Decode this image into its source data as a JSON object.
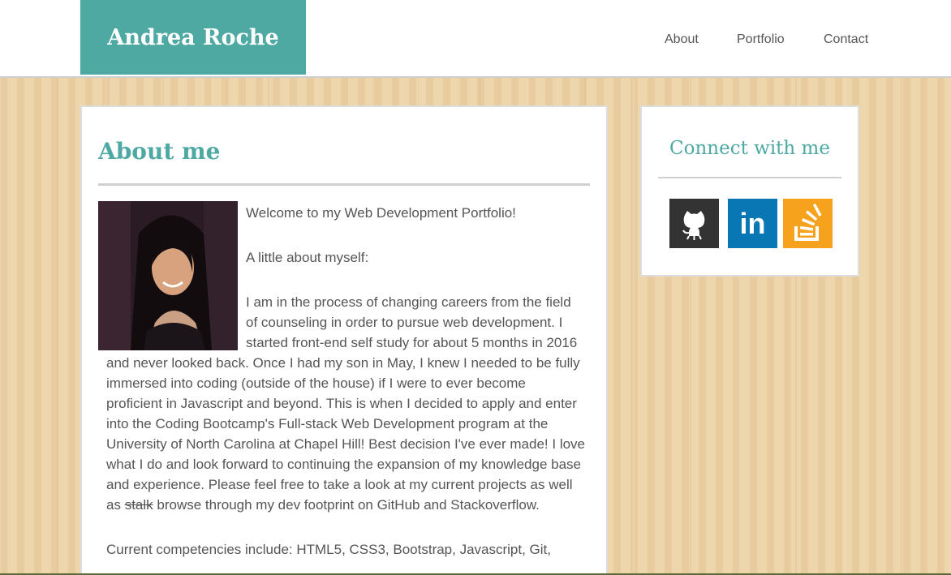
{
  "header": {
    "brand": "Andrea Roche",
    "nav": [
      {
        "label": "About"
      },
      {
        "label": "Portfolio"
      },
      {
        "label": "Contact"
      }
    ]
  },
  "about": {
    "title": "About me",
    "welcome": "Welcome to my Web Development Portfolio!",
    "intro": "A little about myself:",
    "para_start": "I am in the process of changing careers from the field of counseling in order to pursue web development. I started front-end self study for about 5 months in 2016 and never looked back. Once I had my son in May, I knew I needed to be fully immersed into coding (outside of the house) if I were to ever become proficient in Javascript and beyond. This is when I decided to apply and enter into the Coding Bootcamp's Full-stack Web Development program at the University of North Carolina at Chapel Hill! Best decision I've ever made! I love what I do and look forward to continuing the expansion of my knowledge base and experience. Please feel free to take a look at my current projects as well as ",
    "para_strike": "stalk",
    "para_end": " browse through my dev footprint on GitHub and Stackoverflow.",
    "competencies": "Current competencies include: HTML5, CSS3, Bootstrap, Javascript, Git,"
  },
  "connect": {
    "title": "Connect with me",
    "links": [
      {
        "icon": "github-icon",
        "color": "#333333"
      },
      {
        "icon": "linkedin-icon",
        "label": "in",
        "color": "#0a77b5"
      },
      {
        "icon": "stackoverflow-icon",
        "color": "#f7a21c"
      }
    ]
  }
}
